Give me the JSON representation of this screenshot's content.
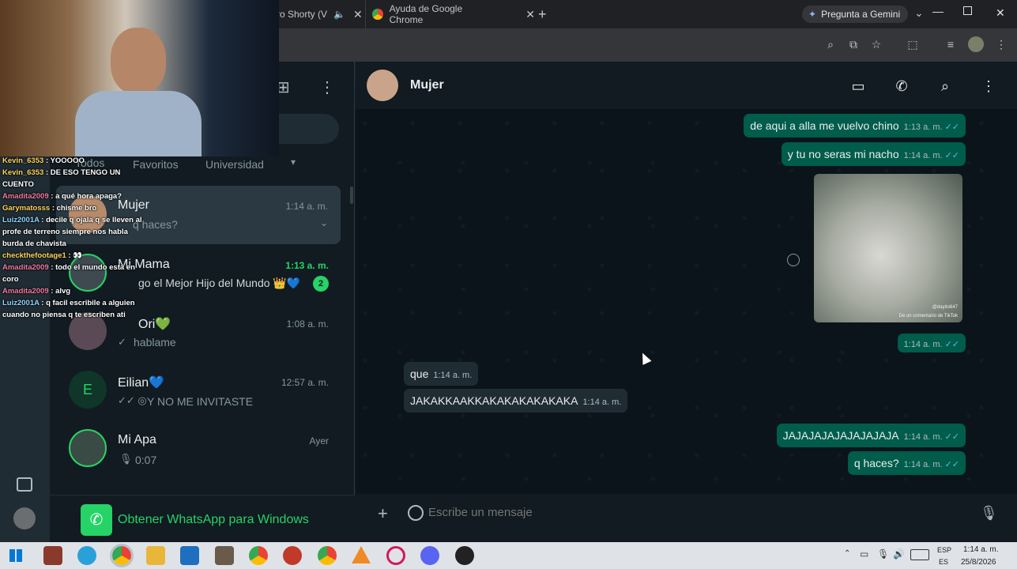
{
  "browser": {
    "tabs": [
      {
        "title": "ro Shorty (V"
      },
      {
        "title": "Ayuda de Google Chrome"
      }
    ],
    "gemini_label": "Pregunta a Gemini"
  },
  "stream_overlay": {
    "chat": [
      {
        "user": "Kevin_6353",
        "text": ": YOOOOO"
      },
      {
        "user": "Kevin_6353",
        "text": ": DE ESO TENGO UN CUENTO"
      },
      {
        "user": "Amadita2009",
        "text": ": a qué hora apaga?"
      },
      {
        "user": "Garymatosss",
        "text": ": chisme bro"
      },
      {
        "user": "Luiz2001A",
        "text": ": decile q ojala q se lleven al profe de terreno siempre nos habla burda de chavista"
      },
      {
        "user": "checkthefootage1",
        "text": ": 👀"
      },
      {
        "user": "Amadita2009",
        "text": ": todo el mundo está en coro"
      },
      {
        "user": "Amadita2009",
        "text": ": alvg"
      },
      {
        "user": "Luiz2001A",
        "text": ": q facil escribile a alguien cuando no piensa q te escriben ati"
      }
    ]
  },
  "chatlist": {
    "filters": [
      "Todos",
      "Favoritos",
      "Universidad"
    ],
    "chats": [
      {
        "name": "Mujer",
        "preview": "q haces?",
        "time": "1:14 a. m."
      },
      {
        "name": "Mi Mama",
        "preview": "go el Mejor Hijo del Mundo 👑💙",
        "time": "1:13 a. m.",
        "unread": "2"
      },
      {
        "name": "Ori💚",
        "preview": "hablame",
        "time": "1:08 a. m."
      },
      {
        "name": "Eilian💙",
        "preview": "Y NO ME INVITASTE",
        "time": "12:57 a. m.",
        "avatar_letter": "E"
      },
      {
        "name": "Mi Apa",
        "preview": "0:07",
        "time": "Ayer"
      }
    ],
    "get_app_label": "Obtener WhatsApp para Windows"
  },
  "conversation": {
    "contact_name": "Mujer",
    "messages": [
      {
        "dir": "out",
        "text": "de aqui a alla me vuelvo chino",
        "time": "1:13 a. m."
      },
      {
        "dir": "out",
        "text": "y tu no seras mi nacho",
        "time": "1:14 a. m."
      },
      {
        "dir": "out",
        "image_caption": "De un comentario de TikTok",
        "image_handle": "@dayito647",
        "time": "1:14 a. m."
      },
      {
        "dir": "in",
        "text": "que",
        "time": "1:14 a. m."
      },
      {
        "dir": "in",
        "text": "JAKAKKAAKKAKAKAKAKAKAKA",
        "time": "1:14 a. m."
      },
      {
        "dir": "out",
        "text": "JAJAJAJAJAJAJAJAJA",
        "time": "1:14 a. m."
      },
      {
        "dir": "out",
        "text": "q haces?",
        "time": "1:14 a. m."
      }
    ],
    "composer_placeholder": "Escribe un mensaje"
  },
  "taskbar": {
    "lang_top": "ESP",
    "lang_bottom": "ES",
    "clock_time": "1:14 a. m.",
    "clock_date": "25/8/2026"
  },
  "colors": {
    "accent_green": "#25d366",
    "outgoing_bubble": "#005c4b",
    "incoming_bubble": "#202c33",
    "read_tick": "#53bdeb"
  }
}
